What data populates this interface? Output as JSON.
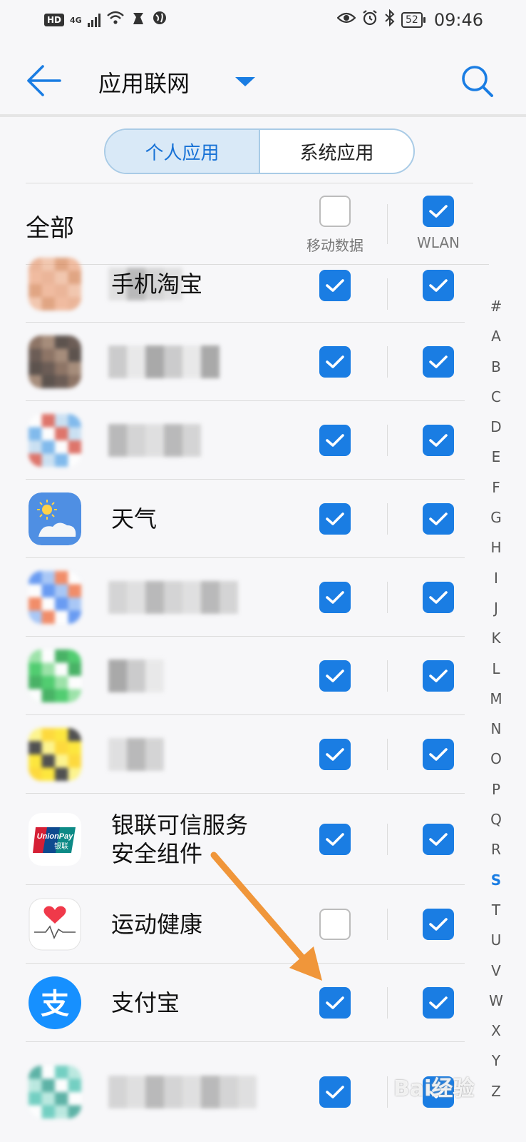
{
  "status_bar": {
    "hd": "HD",
    "network": "4G",
    "battery": "52",
    "time": "09:46"
  },
  "header": {
    "title": "应用联网"
  },
  "tabs": [
    {
      "label": "个人应用",
      "active": true
    },
    {
      "label": "系统应用",
      "active": false
    }
  ],
  "list_header": {
    "all_label": "全部",
    "mobile_label": "移动数据",
    "wlan_label": "WLAN",
    "mobile_checked": false,
    "wlan_checked": true
  },
  "apps": [
    {
      "name": "手机淘宝",
      "mobile": true,
      "wlan": true
    },
    {
      "name": "",
      "mobile": true,
      "wlan": true
    },
    {
      "name": "",
      "mobile": true,
      "wlan": true
    },
    {
      "name": "天气",
      "mobile": true,
      "wlan": true
    },
    {
      "name": "",
      "mobile": true,
      "wlan": true
    },
    {
      "name": "",
      "mobile": true,
      "wlan": true
    },
    {
      "name": "",
      "mobile": true,
      "wlan": true
    },
    {
      "name": "银联可信服务\n安全组件",
      "mobile": true,
      "wlan": true
    },
    {
      "name": "运动健康",
      "mobile": false,
      "wlan": true
    },
    {
      "name": "支付宝",
      "mobile": true,
      "wlan": true
    },
    {
      "name": "",
      "mobile": true,
      "wlan": true
    }
  ],
  "app_icon_labels": {
    "unionpay": "UnionPay",
    "unionpay_cn": "银联",
    "alipay": "支"
  },
  "alphabet": [
    "#",
    "A",
    "B",
    "C",
    "D",
    "E",
    "F",
    "G",
    "H",
    "I",
    "J",
    "K",
    "L",
    "M",
    "N",
    "O",
    "P",
    "Q",
    "R",
    "S",
    "T",
    "U",
    "V",
    "W",
    "X",
    "Y",
    "Z"
  ],
  "alphabet_current": "S",
  "watermark": "Bai经验",
  "colors": {
    "accent": "#1a7de3",
    "arrow": "#f0963a"
  }
}
